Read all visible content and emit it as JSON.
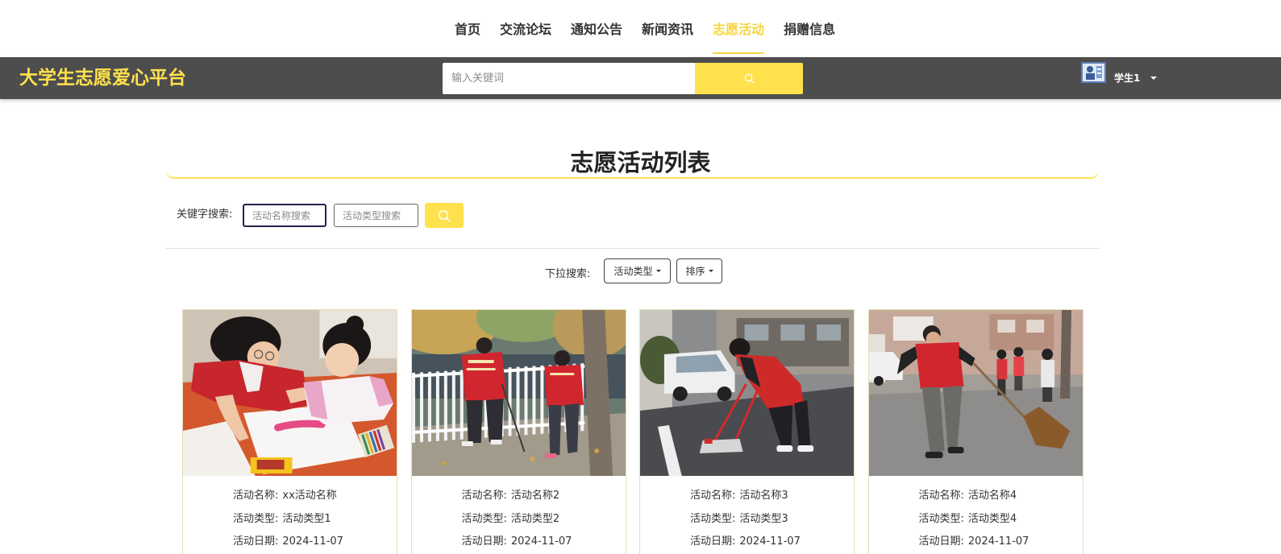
{
  "nav": {
    "items": [
      {
        "label": "首页",
        "active": false
      },
      {
        "label": "交流论坛",
        "active": false
      },
      {
        "label": "通知公告",
        "active": false
      },
      {
        "label": "新闻资讯",
        "active": false
      },
      {
        "label": "志愿活动",
        "active": true
      },
      {
        "label": "捐赠信息",
        "active": false
      }
    ]
  },
  "header": {
    "site_title": "大学生志愿爱心平台",
    "search_placeholder": "输入关键词",
    "search_value": "",
    "search_button_icon": "search-icon",
    "user_name": "学生1",
    "user_menu_icon": "caret-down-icon"
  },
  "page_title": "志愿活动列表",
  "keyword_search": {
    "label": "关键字搜索:",
    "activity_name_placeholder": "活动名称搜索",
    "activity_name_value": "",
    "activity_type_placeholder": "活动类型搜索",
    "activity_type_value": "",
    "button_icon": "search-icon"
  },
  "dropdown_search": {
    "label": "下拉搜索:",
    "activity_type_dropdown": "活动类型",
    "sort_dropdown": "排序",
    "dropdown_icon": "caret-down-icon"
  },
  "card_labels": {
    "name": "活动名称:",
    "type": "活动类型:",
    "date": "活动日期:"
  },
  "activities": [
    {
      "name": "xx活动名称",
      "type": "活动类型1",
      "date": "2024-11-07"
    },
    {
      "name": "活动名称2",
      "type": "活动类型2",
      "date": "2024-11-07"
    },
    {
      "name": "活动名称3",
      "type": "活动类型3",
      "date": "2024-11-07"
    },
    {
      "name": "活动名称4",
      "type": "活动类型4",
      "date": "2024-11-07"
    }
  ],
  "colors": {
    "accent": "#ffe14d",
    "nav_active": "#f6d53f",
    "header_background": "#4d4d4d",
    "text": "#333333",
    "card_border": "#e3e0b6",
    "focus_border": "#23234a"
  }
}
